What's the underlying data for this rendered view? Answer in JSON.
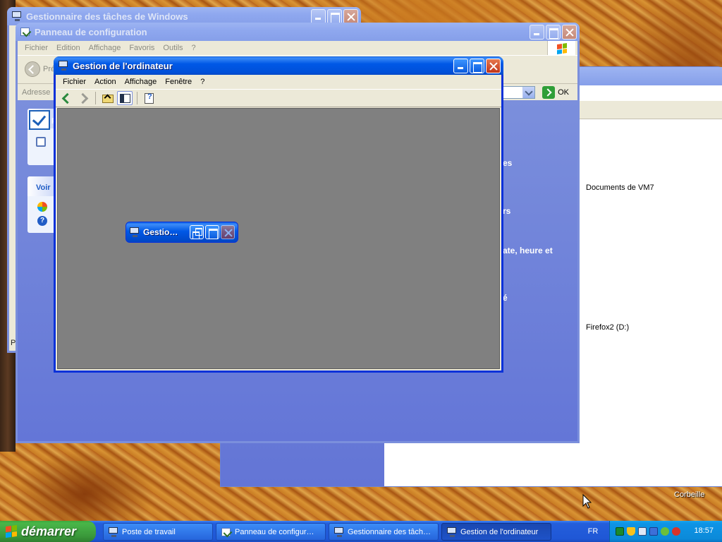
{
  "desktop": {
    "recycle_bin_label": "Corbeille"
  },
  "explorer_bg": {
    "item_documents": "Documents de VM7",
    "item_drive": "Firefox2 (D:)"
  },
  "taskmgr": {
    "title": "Gestionnaire des tâches de Windows",
    "status_fragment": "P"
  },
  "cpanel": {
    "title": "Panneau de configuration",
    "menu": [
      "Fichier",
      "Edition",
      "Affichage",
      "Favoris",
      "Outils",
      "?"
    ],
    "back_label": "Pré",
    "address_label": "Adresse",
    "go_label": "OK",
    "see_also_header": "Voir",
    "side_fragment": "P",
    "category_fragments": [
      "es",
      "rs",
      "ate, heure et",
      "é"
    ]
  },
  "compmgmt": {
    "title": "Gestion de l'ordinateur",
    "menu": [
      "Fichier",
      "Action",
      "Affichage",
      "Fenêtre",
      "?"
    ],
    "toolbar_icons": [
      "back-arrow-icon",
      "forward-arrow-icon",
      "up-folder-icon",
      "show-hide-tree-icon",
      "properties-help-icon"
    ],
    "minimized_child_title": "Gestio…"
  },
  "taskbar": {
    "start_label": "démarrer",
    "tasks": [
      {
        "label": "Poste de travail",
        "icon": "my-computer-icon"
      },
      {
        "label": "Panneau de configur…",
        "icon": "control-panel-icon"
      },
      {
        "label": "Gestionnaire des tâch…",
        "icon": "task-manager-icon"
      },
      {
        "label": "Gestion de l'ordinateur",
        "icon": "computer-management-icon",
        "active": true
      }
    ],
    "language": "FR",
    "clock": "18:57",
    "tray_icons": [
      "network-icon",
      "security-shield-icon",
      "display-icon",
      "network-connection-icon",
      "wireless-icon",
      "alert-icon"
    ]
  },
  "colors": {
    "xp_blue": "#0058e6",
    "mdi_background": "#808080",
    "taskbar_blue": "#245edb",
    "start_green": "#3b9a3b",
    "tray_blue": "#0b8ad9"
  }
}
